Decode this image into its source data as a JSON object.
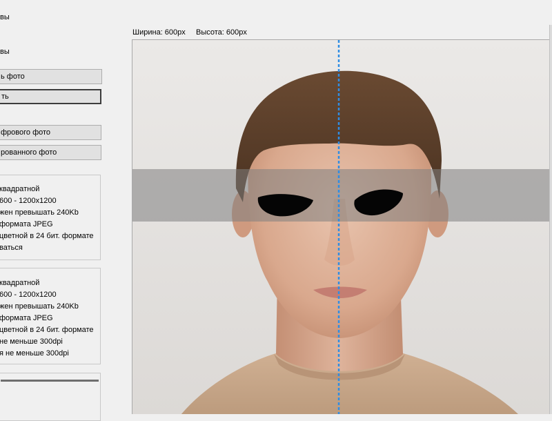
{
  "header": {
    "top_partial": "вы",
    "section_partial": "вы"
  },
  "buttons": {
    "load_photo": "ь фото",
    "save": "ть",
    "digital_photo": "фрового фото",
    "scanned_photo": "рованного фото"
  },
  "requirements_digital": [
    "квадратной",
    "600 - 1200x1200",
    "жен превышать 240Kb",
    "формата JPEG",
    "цветной в 24 бит. формате",
    "ваться"
  ],
  "requirements_scanned": [
    "квадратной",
    "600 - 1200x1200",
    "жен превышать 240Kb",
    "формата JPEG",
    "цветной в 24 бит. формате",
    "не меньше 300dpi",
    "я не меньше 300dpi"
  ],
  "photo_info": {
    "width_label": "Ширина: 600px",
    "height_label": "Высота: 600px"
  },
  "colors": {
    "guide_line": "#2f8de4",
    "eye_band": "#808080",
    "background_wall": "#e6e4e2",
    "shirt": "#c8a88a"
  }
}
